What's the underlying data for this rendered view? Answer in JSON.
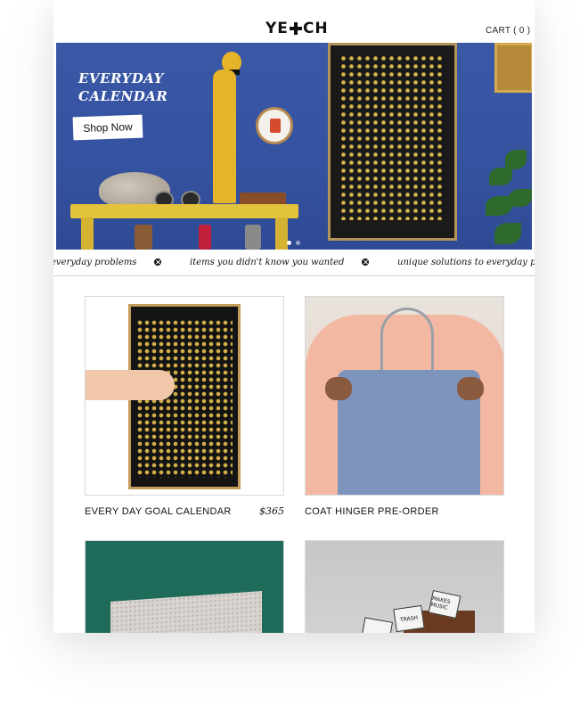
{
  "header": {
    "logo_left": "YE",
    "logo_right": "CH",
    "cart_label": "CART ( 0 )"
  },
  "hero": {
    "title_line1": "EVERYDAY",
    "title_line2": "CALENDAR",
    "cta_label": "Shop Now",
    "slide_count": 2,
    "active_slide": 1
  },
  "ticker": {
    "items": [
      "everyday problems",
      "items you didn't know you wanted",
      "unique solutions to everyday problems"
    ]
  },
  "products": [
    {
      "name": "EVERY DAY GOAL CALENDAR",
      "price": "$365"
    },
    {
      "name": "COAT HINGER PRE-ORDER",
      "price": ""
    },
    {
      "name": "",
      "price": ""
    },
    {
      "name": "",
      "price": "",
      "cube_labels": [
        "MAKES MUSIC",
        "TRASH"
      ]
    }
  ],
  "colors": {
    "hero_wall": "#3b5aa8",
    "shelf_yellow": "#e3c23c",
    "gold_dots": "#d8b54a"
  }
}
